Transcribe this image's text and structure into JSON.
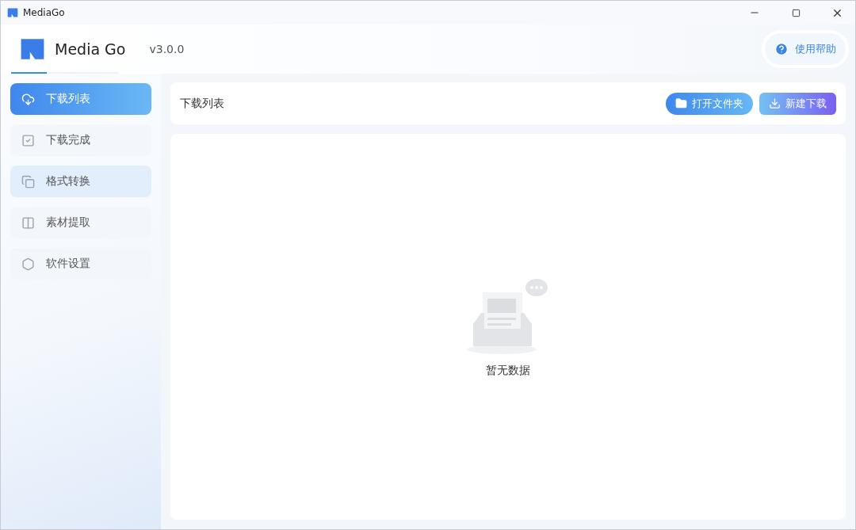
{
  "window": {
    "title": "MediaGo"
  },
  "header": {
    "app_name": "Media Go",
    "version": "v3.0.0",
    "help": "使用帮助"
  },
  "sidebar": {
    "items": [
      {
        "label": "下载列表",
        "selected": true,
        "hovered": false,
        "kind": "download"
      },
      {
        "label": "下载完成",
        "selected": false,
        "hovered": false,
        "kind": "done"
      },
      {
        "label": "格式转换",
        "selected": false,
        "hovered": true,
        "kind": "convert"
      },
      {
        "label": "素材提取",
        "selected": false,
        "hovered": false,
        "kind": "extract"
      },
      {
        "label": "软件设置",
        "selected": false,
        "hovered": false,
        "kind": "settings"
      }
    ]
  },
  "toolbar": {
    "title": "下载列表",
    "open_folder": "打开文件夹",
    "new_download": "新建下载"
  },
  "empty_state": {
    "text": "暂无数据"
  }
}
